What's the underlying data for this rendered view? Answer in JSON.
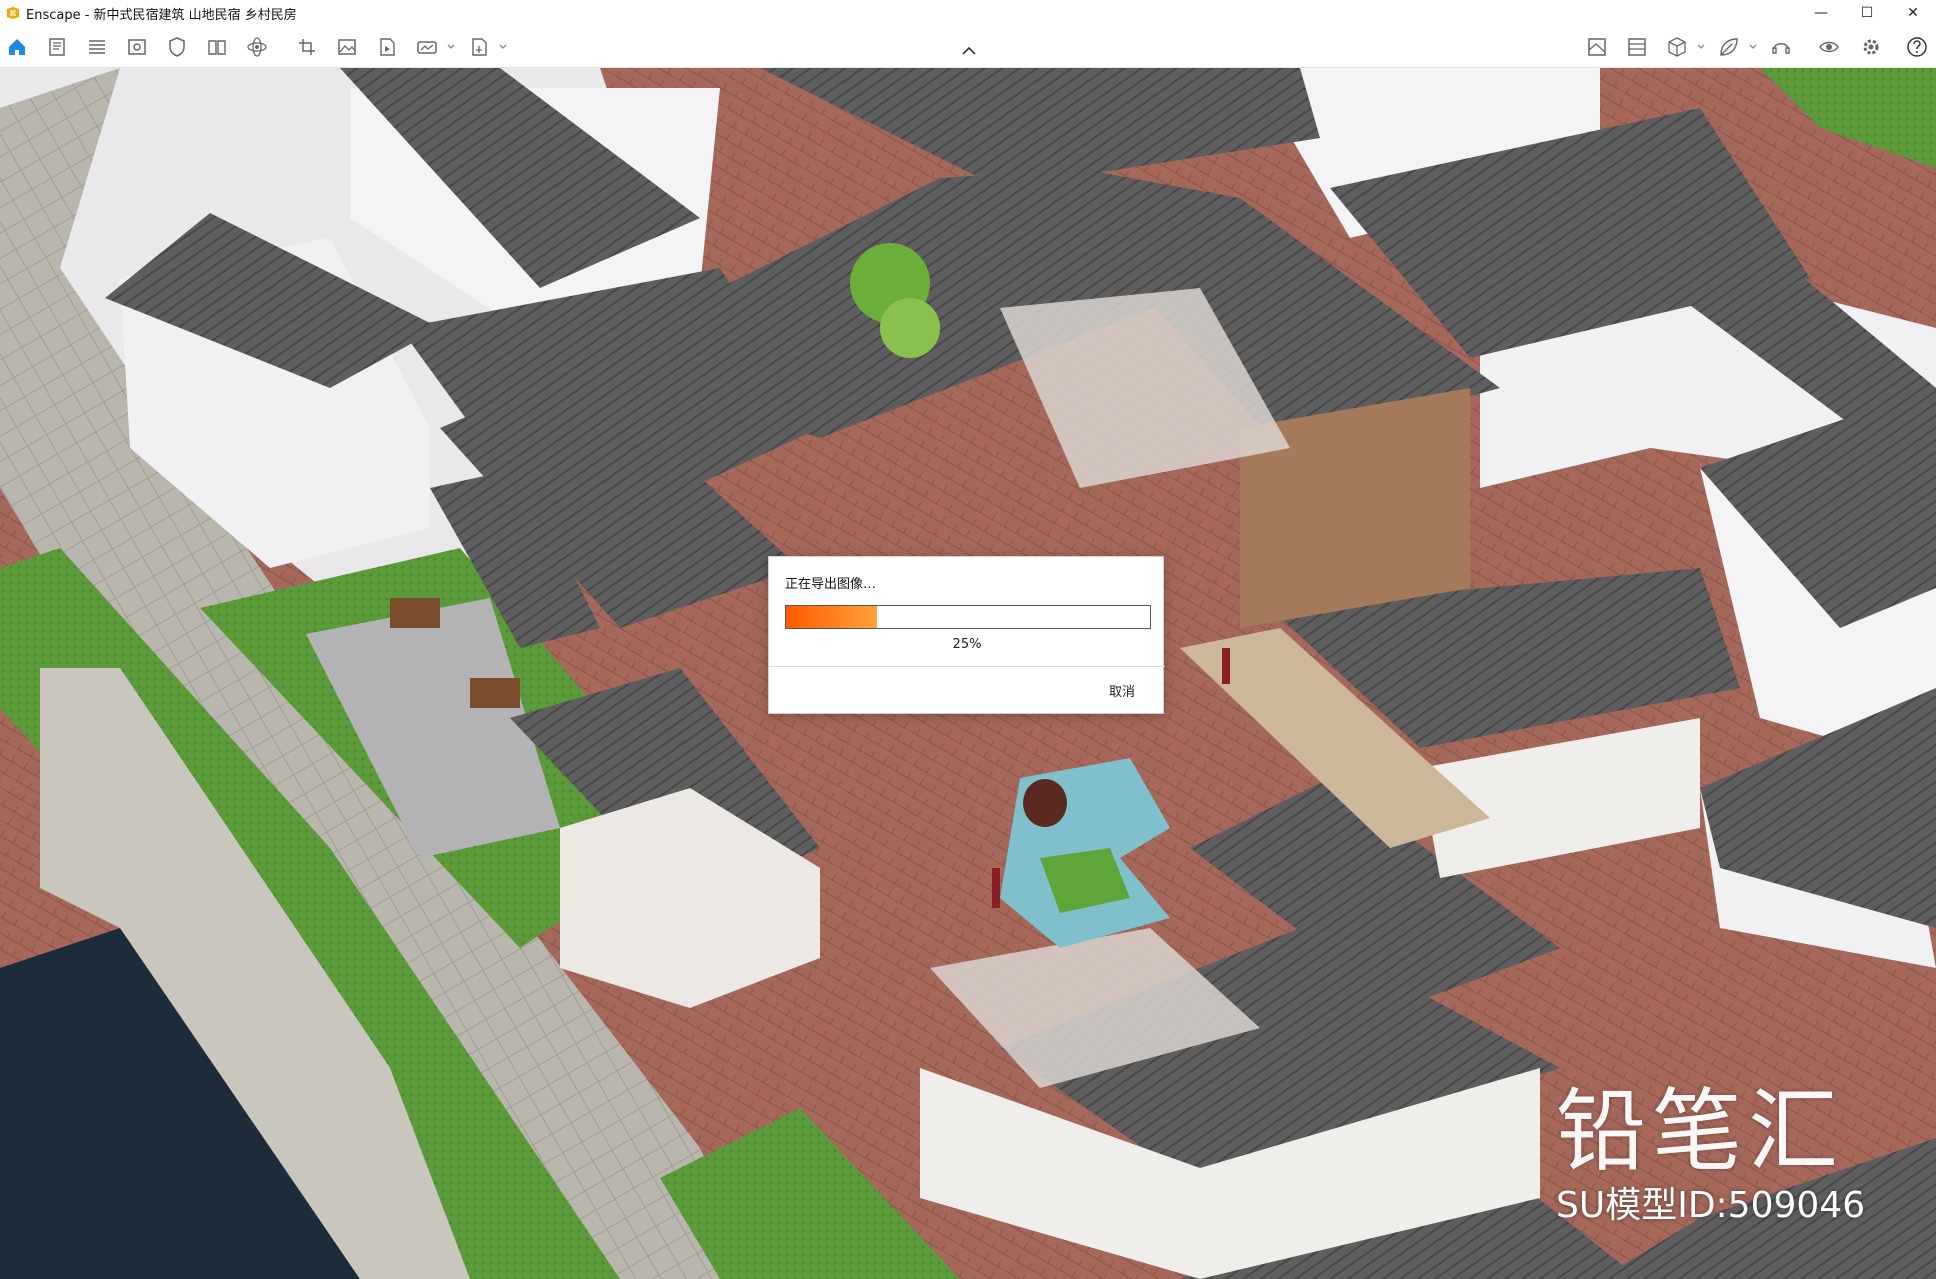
{
  "window": {
    "title": "Enscape - 新中式民宿建筑 山地民宿 乡村民房",
    "minimize": "—",
    "maximize": "☐",
    "close": "✕"
  },
  "toolbar": {
    "icons": [
      "home-icon",
      "document-icon",
      "list-icon",
      "view-icon",
      "shield-icon",
      "book-icon",
      "atom-icon",
      "crop-icon",
      "image-icon",
      "video-file-icon",
      "panorama-icon",
      "export-file-icon"
    ],
    "right_icons": [
      "map-icon",
      "gallery-icon",
      "cube-icon",
      "leaf-icon",
      "headset-icon",
      "eye-icon",
      "settings-icon",
      "help-icon"
    ],
    "accent": "#1e88e5"
  },
  "dialog": {
    "message": "正在导出图像…",
    "progress": 25,
    "percent_label": "25%",
    "cancel_label": "取消",
    "bar_color": "#ff6a00"
  },
  "watermark": {
    "brand": "铅笔汇",
    "model_id": "SU模型ID:509046"
  }
}
